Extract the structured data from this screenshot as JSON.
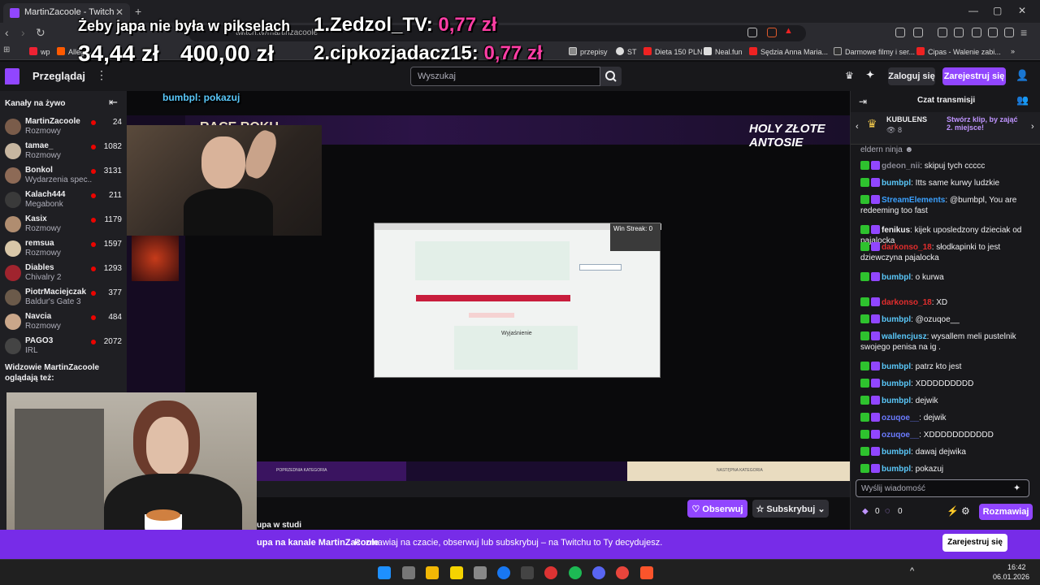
{
  "browser": {
    "tab_title": "MartinZacoole - Twitch",
    "url": "twitch.tv/martinzacoole",
    "bookmarks": [
      "wp",
      "Allegro",
      "przepisy",
      "ST",
      "Dieta 150 PLN",
      "Neal.fun",
      "Sędzia Anna Maria...",
      "Darmowe filmy i ser...",
      "Cipas - Walenie zabi..."
    ]
  },
  "overlay": {
    "line1": "Żeby japa nie była w pikselach",
    "amount1": "34,44 zł",
    "amount2": "400,00 zł",
    "rank1": "1.Zedzol_TV:",
    "rank1_amount": "0,77 zł",
    "rank2": "2.cipkozjadacz15:",
    "rank2_amount": "0,77 zł",
    "top_msg_user": "bumbpl:",
    "top_msg_text": "pokazuj",
    "race_title": "RACE ROKU",
    "win_streak": "Win Streak: 0"
  },
  "topnav": {
    "browse": "Przeglądaj",
    "search_placeholder": "Wyszukaj",
    "login": "Zaloguj się",
    "signup": "Zarejestruj się"
  },
  "sidebar": {
    "header": "Kanały na żywo",
    "channels": [
      {
        "name": "MartinZacoole",
        "category": "Rozmowy",
        "viewers": "24"
      },
      {
        "name": "tamae_",
        "category": "Rozmowy",
        "viewers": "1082"
      },
      {
        "name": "Bonkol",
        "category": "Wydarzenia spec...",
        "viewers": "3131"
      },
      {
        "name": "Kalach444",
        "category": "Megabonk",
        "viewers": "211"
      },
      {
        "name": "Kasix",
        "category": "Rozmowy",
        "viewers": "1179"
      },
      {
        "name": "remsua",
        "category": "Rozmowy",
        "viewers": "1597"
      },
      {
        "name": "Diables",
        "category": "Chivalry 2",
        "viewers": "1293"
      },
      {
        "name": "PiotrMaciejczak",
        "category": "Baldur's Gate 3",
        "viewers": "377"
      },
      {
        "name": "Navcia",
        "category": "Rozmowy",
        "viewers": "484"
      },
      {
        "name": "PAGO3",
        "category": "IRL",
        "viewers": "2072"
      }
    ],
    "also_watching": "Widzowie MartinZacoole oglądają też:"
  },
  "chat": {
    "title": "Czat transmisji",
    "pinned_user": "KUBULENS",
    "pinned_count": "8",
    "pinned_text": "Stwórz klip, by zająć 2. miejsce!",
    "messages": [
      {
        "user": "gdeon_nii",
        "text": "skipuj tych ccccc",
        "color": "#8a8a95"
      },
      {
        "user": "bumbpl",
        "text": "Itts same kurwy ludzkie",
        "color": "#5ac8fa"
      },
      {
        "user": "StreamElements",
        "text": "@bumbpl, You are redeeming too fast",
        "color": "#3ba1ff"
      },
      {
        "user": "fenikus",
        "text": "kijek uposledzony dzieciak od pajalocka",
        "color": "#efeff1"
      },
      {
        "user": "darkonso_18",
        "text": "słodkapinki to jest dziewczyna pajalocka",
        "color": "#e22d2d"
      },
      {
        "user": "bumbpl",
        "text": "o kurwa",
        "color": "#5ac8fa"
      },
      {
        "user": "darkonso_18",
        "text": "XD",
        "color": "#e22d2d"
      },
      {
        "user": "bumbpl",
        "text": "@ozuqoe__",
        "color": "#5ac8fa"
      },
      {
        "user": "wallencjusz",
        "text": "wysallem meli pustelnik swojego penisa na ig .",
        "color": "#5ac8fa"
      },
      {
        "user": "bumbpl",
        "text": "patrz kto jest",
        "color": "#5ac8fa"
      },
      {
        "user": "bumbpl",
        "text": "XDDDDDDDDD",
        "color": "#5ac8fa"
      },
      {
        "user": "bumbpl",
        "text": "dejwik",
        "color": "#5ac8fa"
      },
      {
        "user": "ozuqoe__",
        "text": "dejwik",
        "color": "#6b7bff"
      },
      {
        "user": "ozuqoe__",
        "text": "XDDDDDDDDDDD",
        "color": "#6b7bff"
      },
      {
        "user": "bumbpl",
        "text": "dawaj dejwika",
        "color": "#5ac8fa"
      },
      {
        "user": "bumbpl",
        "text": "pokazuj",
        "color": "#5ac8fa"
      }
    ],
    "input_placeholder": "Wyślij wiadomość",
    "points1": "0",
    "points2": "0",
    "send": "Rozmawiaj"
  },
  "stream_bar": {
    "follow": "Obserwuj",
    "subscribe": "Subskrybuj",
    "title_partial": "upa w studi",
    "prev_category": "POPRZEDNIA KATEGORIA",
    "next_category": "NASTĘPNA KATEGORIA"
  },
  "banner": {
    "prefix": "upa na kanale MartinZacoole",
    "text": "Rozmawiaj na czacie, obserwuj lub subskrybuj – na Twitchu to Ty decydujesz.",
    "signup": "Zarejestruj się"
  },
  "taskbar": {
    "time": "16:42",
    "date": "06.01.2026"
  },
  "colors": {
    "twitch_purple": "#9146ff",
    "overlay_pink": "#ff3ea5",
    "banner": "#772ce8"
  }
}
